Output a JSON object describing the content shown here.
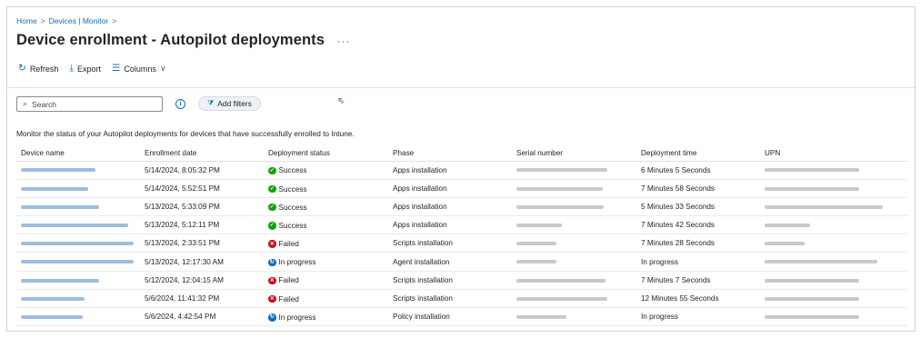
{
  "breadcrumb": [
    "Home",
    "Devices | Monitor"
  ],
  "page_title": "Device enrollment - Autopilot deployments",
  "more_label": "···",
  "toolbar": {
    "refresh_label": "Refresh",
    "export_label": "Export",
    "columns_label": "Columns"
  },
  "search": {
    "placeholder": "Search"
  },
  "add_filters_label": "Add filters",
  "description": "Monitor the status of your Autopilot deployments for devices that have successfully enrolled to Intune.",
  "columns": [
    "Device name",
    "Enrollment date",
    "Deployment status",
    "Phase",
    "Serial number",
    "Deployment time",
    "UPN"
  ],
  "status_colors": {
    "success": "#13a10e",
    "failed": "#c50f1f",
    "in_progress": "#0f6cbd"
  },
  "rows": [
    {
      "enrollment_date": "5/14/2024, 8:05:32 PM",
      "status": "Success",
      "status_key": "success",
      "phase": "Apps installation",
      "deployment_time": "6 Minutes 5 Seconds"
    },
    {
      "enrollment_date": "5/14/2024, 5:52:51 PM",
      "status": "Success",
      "status_key": "success",
      "phase": "Apps installation",
      "deployment_time": "7 Minutes 58 Seconds"
    },
    {
      "enrollment_date": "5/13/2024, 5:33:09 PM",
      "status": "Success",
      "status_key": "success",
      "phase": "Apps installation",
      "deployment_time": "5 Minutes 33 Seconds"
    },
    {
      "enrollment_date": "5/13/2024, 5:12:11 PM",
      "status": "Success",
      "status_key": "success",
      "phase": "Apps installation",
      "deployment_time": "7 Minutes 42 Seconds"
    },
    {
      "enrollment_date": "5/13/2024, 2:33:51 PM",
      "status": "Failed",
      "status_key": "failed",
      "phase": "Scripts installation",
      "deployment_time": "7 Minutes 28 Seconds"
    },
    {
      "enrollment_date": "5/13/2024, 12:17:30 AM",
      "status": "In progress",
      "status_key": "in_progress",
      "phase": "Agent installation",
      "deployment_time": "In progress"
    },
    {
      "enrollment_date": "5/12/2024, 12:04:15 AM",
      "status": "Failed",
      "status_key": "failed",
      "phase": "Scripts installation",
      "deployment_time": "7 Minutes 7 Seconds"
    },
    {
      "enrollment_date": "5/6/2024, 11:41:32 PM",
      "status": "Failed",
      "status_key": "failed",
      "phase": "Scripts installation",
      "deployment_time": "12 Minutes 55 Seconds"
    },
    {
      "enrollment_date": "5/6/2024, 4:42:54 PM",
      "status": "In progress",
      "status_key": "in_progress",
      "phase": "Policy installation",
      "deployment_time": "In progress"
    }
  ]
}
